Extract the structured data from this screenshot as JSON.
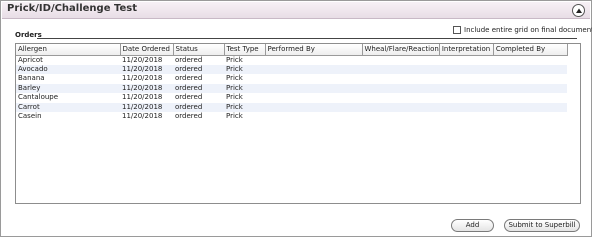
{
  "panel": {
    "title": "Prick/ID/Challenge Test"
  },
  "options": {
    "include_grid_label": "Include entire grid on final document",
    "include_grid_checked": false
  },
  "orders": {
    "label": "Orders"
  },
  "grid": {
    "columns": [
      "Allergen",
      "Date Ordered",
      "Status",
      "Test Type",
      "Performed By",
      "Wheal/Flare/Reaction",
      "Interpretation",
      "Completed By"
    ],
    "rows": [
      {
        "allergen": "Apricot",
        "date": "11/20/2018",
        "status": "ordered",
        "type": "Prick",
        "performed_by": "",
        "reaction": "",
        "interpretation": "",
        "completed_by": ""
      },
      {
        "allergen": "Avocado",
        "date": "11/20/2018",
        "status": "ordered",
        "type": "Prick",
        "performed_by": "",
        "reaction": "",
        "interpretation": "",
        "completed_by": ""
      },
      {
        "allergen": "Banana",
        "date": "11/20/2018",
        "status": "ordered",
        "type": "Prick",
        "performed_by": "",
        "reaction": "",
        "interpretation": "",
        "completed_by": ""
      },
      {
        "allergen": "Barley",
        "date": "11/20/2018",
        "status": "ordered",
        "type": "Prick",
        "performed_by": "",
        "reaction": "",
        "interpretation": "",
        "completed_by": ""
      },
      {
        "allergen": "Cantaloupe",
        "date": "11/20/2018",
        "status": "ordered",
        "type": "Prick",
        "performed_by": "",
        "reaction": "",
        "interpretation": "",
        "completed_by": ""
      },
      {
        "allergen": "Carrot",
        "date": "11/20/2018",
        "status": "ordered",
        "type": "Prick",
        "performed_by": "",
        "reaction": "",
        "interpretation": "",
        "completed_by": ""
      },
      {
        "allergen": "Casein",
        "date": "11/20/2018",
        "status": "ordered",
        "type": "Prick",
        "performed_by": "",
        "reaction": "",
        "interpretation": "",
        "completed_by": ""
      }
    ]
  },
  "buttons": {
    "add": "Add",
    "submit": "Submit to Superbill"
  }
}
